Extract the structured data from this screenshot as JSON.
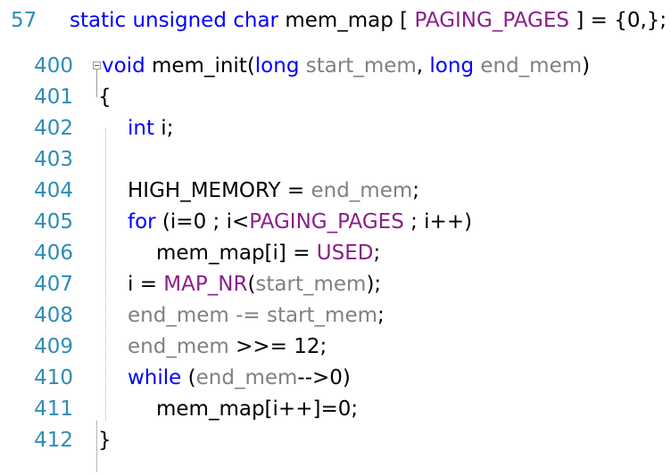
{
  "editor": {
    "colors": {
      "background": "#ffffff",
      "line_number": "#2e8cb4",
      "keyword": "#0000ff",
      "plain": "#000000",
      "variable": "#808080",
      "macro": "#8b1f8b",
      "indent_guide": "#b6b6b6"
    },
    "fold_marker": "collapse-minus-box",
    "header_line": {
      "number": "57",
      "tokens": [
        {
          "text": "static unsigned char ",
          "type": "keyword"
        },
        {
          "text": "mem_map [ ",
          "type": "plain"
        },
        {
          "text": "PAGING_PAGES",
          "type": "macro"
        },
        {
          "text": " ] = {0,};",
          "type": "plain"
        }
      ],
      "plain_text": "static unsigned char mem_map [ PAGING_PAGES ] = {0,};"
    },
    "lines": [
      {
        "number": "400",
        "plain_text": "void mem_init(long start_mem, long end_mem)",
        "t1": "void ",
        "t2": "mem_init(",
        "t3": "long ",
        "t4": "start_mem",
        "t5": ", ",
        "t6": "long ",
        "t7": "end_mem",
        "t8": ")"
      },
      {
        "number": "401",
        "plain_text": "{",
        "t1": "{"
      },
      {
        "number": "402",
        "plain_text": "int i;",
        "t1": "int",
        "t2": " i;"
      },
      {
        "number": "403",
        "plain_text": ""
      },
      {
        "number": "404",
        "plain_text": "HIGH_MEMORY = end_mem;",
        "t1": "HIGH_MEMORY = ",
        "t2": "end_mem",
        "t3": ";"
      },
      {
        "number": "405",
        "plain_text": "for (i=0 ; i<PAGING_PAGES ; i++)",
        "t1": "for",
        "t2": " (i=0 ; i<",
        "t3": "PAGING_PAGES",
        "t4": " ; i++)"
      },
      {
        "number": "406",
        "plain_text": "mem_map[i] = USED;",
        "t1": "mem_map[i] = ",
        "t2": "USED",
        "t3": ";"
      },
      {
        "number": "407",
        "plain_text": "i = MAP_NR(start_mem);",
        "t1": "i = ",
        "t2": "MAP_NR",
        "t3": "(",
        "t4": "start_mem",
        "t5": ");"
      },
      {
        "number": "408",
        "plain_text": "end_mem -= start_mem;",
        "t1": "end_mem -= start_mem",
        "t2": ";"
      },
      {
        "number": "409",
        "plain_text": "end_mem >>= 12;",
        "t1": "end_mem ",
        "t2": ">>= 12;"
      },
      {
        "number": "410",
        "plain_text": "while (end_mem-->0)",
        "t1": "while",
        "t2": " (",
        "t3": "end_mem",
        "t4": "-->0)"
      },
      {
        "number": "411",
        "plain_text": "mem_map[i++]=0;",
        "t1": "mem_map[i++]=0;"
      },
      {
        "number": "412",
        "plain_text": "}",
        "t1": "}"
      }
    ]
  }
}
